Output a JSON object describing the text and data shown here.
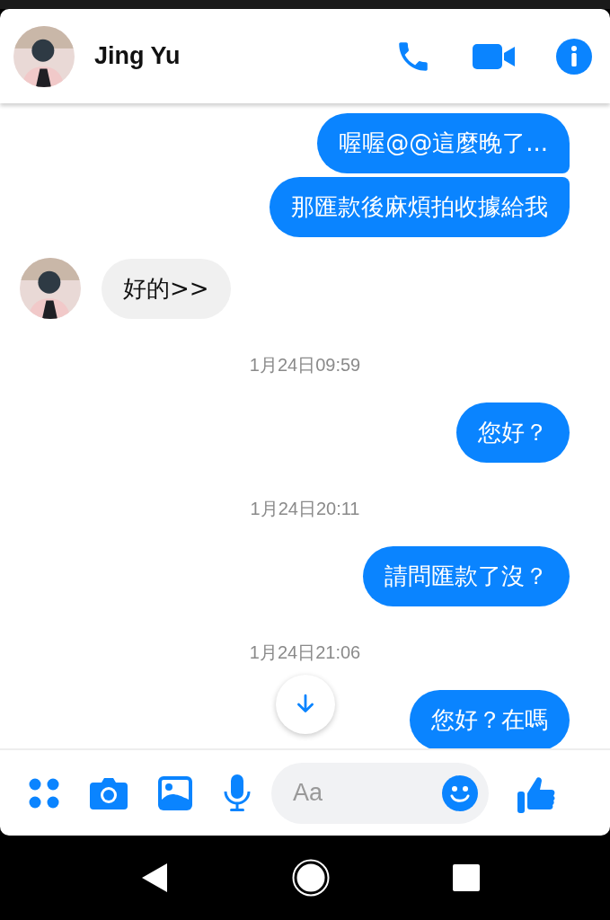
{
  "header": {
    "contact_name": "Jing Yu"
  },
  "messages": [
    {
      "kind": "outgoing",
      "text": "喔喔@@這麼晚了..."
    },
    {
      "kind": "outgoing",
      "text": "那匯款後麻煩拍收據給我"
    },
    {
      "kind": "incoming",
      "text": "好的>>"
    },
    {
      "kind": "timestamp",
      "text": "1月24日09:59"
    },
    {
      "kind": "outgoing",
      "text": "您好？"
    },
    {
      "kind": "timestamp",
      "text": "1月24日20:11"
    },
    {
      "kind": "outgoing",
      "text": "請問匯款了沒？"
    },
    {
      "kind": "timestamp",
      "text": "1月24日21:06"
    },
    {
      "kind": "outgoing",
      "text": "您好？在嗎"
    }
  ],
  "composer": {
    "placeholder": "Aa"
  }
}
